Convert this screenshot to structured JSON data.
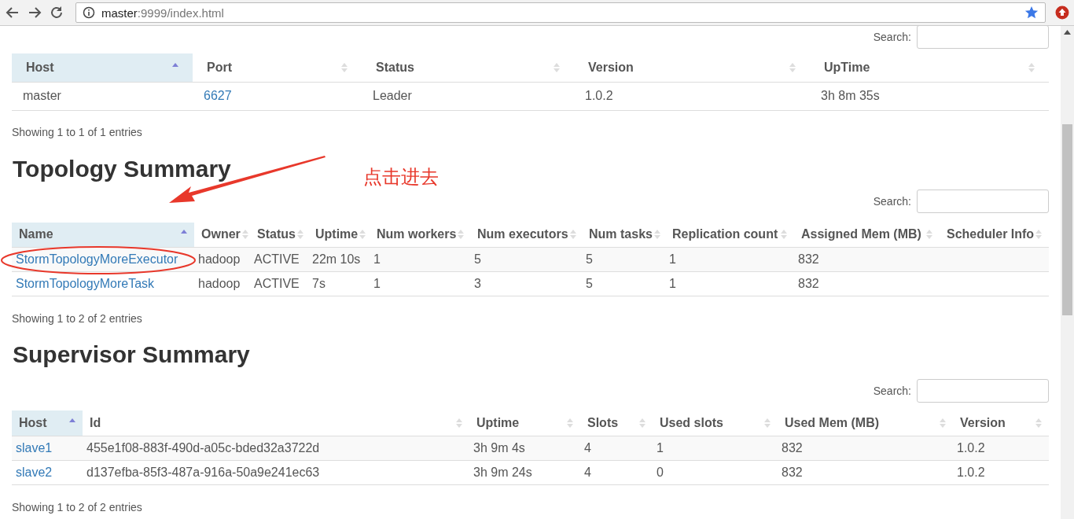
{
  "browser": {
    "url_host": "master",
    "url_path": ":9999/index.html"
  },
  "nimbus_summary": {
    "search_label": "Search:",
    "columns": [
      {
        "label": "Host",
        "sorted": true
      },
      {
        "label": "Port",
        "sorted": false
      },
      {
        "label": "Status",
        "sorted": false
      },
      {
        "label": "Version",
        "sorted": false
      },
      {
        "label": "UpTime",
        "sorted": false
      }
    ],
    "rows": [
      [
        {
          "kind": "text",
          "text": "master"
        },
        {
          "kind": "link",
          "text": "6627"
        },
        {
          "kind": "text",
          "text": "Leader"
        },
        {
          "kind": "text",
          "text": "1.0.2"
        },
        {
          "kind": "text",
          "text": "3h 8m 35s"
        }
      ]
    ],
    "footer": "Showing 1 to 1 of 1 entries"
  },
  "topology_summary": {
    "heading": "Topology Summary",
    "search_label": "Search:",
    "columns": [
      {
        "label": "Name",
        "sorted": true
      },
      {
        "label": "Owner",
        "sorted": false
      },
      {
        "label": "Status",
        "sorted": false
      },
      {
        "label": "Uptime",
        "sorted": false
      },
      {
        "label": "Num workers",
        "sorted": false
      },
      {
        "label": "Num executors",
        "sorted": false
      },
      {
        "label": "Num tasks",
        "sorted": false
      },
      {
        "label": "Replication count",
        "sorted": false
      },
      {
        "label": "Assigned Mem (MB)",
        "sorted": false
      },
      {
        "label": "Scheduler Info",
        "sorted": false
      }
    ],
    "rows": [
      [
        {
          "kind": "link",
          "text": "StormTopologyMoreExecutor"
        },
        {
          "kind": "text",
          "text": "hadoop"
        },
        {
          "kind": "text",
          "text": "ACTIVE"
        },
        {
          "kind": "text",
          "text": "22m 10s"
        },
        {
          "kind": "text",
          "text": "1"
        },
        {
          "kind": "text",
          "text": "5"
        },
        {
          "kind": "text",
          "text": "5"
        },
        {
          "kind": "text",
          "text": "1"
        },
        {
          "kind": "text",
          "text": "832"
        }
      ],
      [
        {
          "kind": "link",
          "text": "StormTopologyMoreTask"
        },
        {
          "kind": "text",
          "text": "hadoop"
        },
        {
          "kind": "text",
          "text": "ACTIVE"
        },
        {
          "kind": "text",
          "text": "7s"
        },
        {
          "kind": "text",
          "text": "1"
        },
        {
          "kind": "text",
          "text": "3"
        },
        {
          "kind": "text",
          "text": "5"
        },
        {
          "kind": "text",
          "text": "1"
        },
        {
          "kind": "text",
          "text": "832"
        }
      ]
    ],
    "footer": "Showing 1 to 2 of 2 entries"
  },
  "supervisor_summary": {
    "heading": "Supervisor Summary",
    "search_label": "Search:",
    "columns": [
      {
        "label": "Host",
        "sorted": true
      },
      {
        "label": "Id",
        "sorted": false
      },
      {
        "label": "Uptime",
        "sorted": false
      },
      {
        "label": "Slots",
        "sorted": false
      },
      {
        "label": "Used slots",
        "sorted": false
      },
      {
        "label": "Used Mem (MB)",
        "sorted": false
      },
      {
        "label": "Version",
        "sorted": false
      }
    ],
    "rows": [
      [
        {
          "kind": "link",
          "text": "slave1"
        },
        {
          "kind": "text",
          "text": "455e1f08-883f-490d-a05c-bded32a3722d"
        },
        {
          "kind": "text",
          "text": "3h 9m 4s"
        },
        {
          "kind": "text",
          "text": "4"
        },
        {
          "kind": "text",
          "text": "1"
        },
        {
          "kind": "text",
          "text": "832"
        },
        {
          "kind": "text",
          "text": "1.0.2"
        }
      ],
      [
        {
          "kind": "link",
          "text": "slave2"
        },
        {
          "kind": "text",
          "text": "d137efba-85f3-487a-916a-50a9e241ec63"
        },
        {
          "kind": "text",
          "text": "3h 9m 24s"
        },
        {
          "kind": "text",
          "text": "4"
        },
        {
          "kind": "text",
          "text": "0"
        },
        {
          "kind": "text",
          "text": "832"
        },
        {
          "kind": "text",
          "text": "1.0.2"
        }
      ]
    ],
    "footer": "Showing 1 to 2 of 2 entries"
  },
  "annotation": {
    "text": "点击进去"
  }
}
